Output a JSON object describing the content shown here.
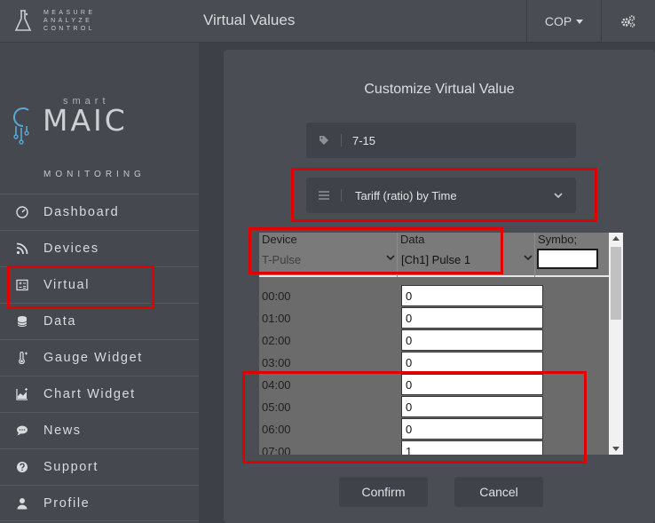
{
  "brand": {
    "lines": [
      "MEASURE",
      "ANALYZE",
      "CONTROL"
    ]
  },
  "header": {
    "title": "Virtual Values",
    "user": "COP"
  },
  "logo": {
    "small": "smart",
    "big": "MAIC",
    "sub": "MONITORING"
  },
  "sidebar": {
    "items": [
      {
        "label": "Dashboard",
        "icon": "gauge-icon"
      },
      {
        "label": "Devices",
        "icon": "rss-icon"
      },
      {
        "label": "Virtual",
        "icon": "calculator-icon"
      },
      {
        "label": "Data",
        "icon": "database-icon"
      },
      {
        "label": "Gauge Widget",
        "icon": "thermometer-icon"
      },
      {
        "label": "Chart Widget",
        "icon": "area-chart-icon"
      },
      {
        "label": "News",
        "icon": "chat-icon"
      },
      {
        "label": "Support",
        "icon": "question-icon"
      },
      {
        "label": "Profile",
        "icon": "user-icon"
      }
    ]
  },
  "modal": {
    "title": "Customize Virtual Value",
    "name_value": "7-15",
    "mode_value": "Tariff (ratio) by Time",
    "table": {
      "headers": {
        "device": "Device",
        "data": "Data",
        "symbol": "Symbo;"
      },
      "device_value": "T-Pulse",
      "data_value": "[Ch1] Pulse 1",
      "rows": [
        {
          "time": "00:00",
          "value": "0"
        },
        {
          "time": "01:00",
          "value": "0"
        },
        {
          "time": "02:00",
          "value": "0"
        },
        {
          "time": "03:00",
          "value": "0"
        },
        {
          "time": "04:00",
          "value": "0"
        },
        {
          "time": "05:00",
          "value": "0"
        },
        {
          "time": "06:00",
          "value": "0"
        },
        {
          "time": "07:00",
          "value": "1"
        }
      ]
    },
    "confirm_label": "Confirm",
    "cancel_label": "Cancel"
  },
  "colors": {
    "highlight": "#e00000"
  }
}
